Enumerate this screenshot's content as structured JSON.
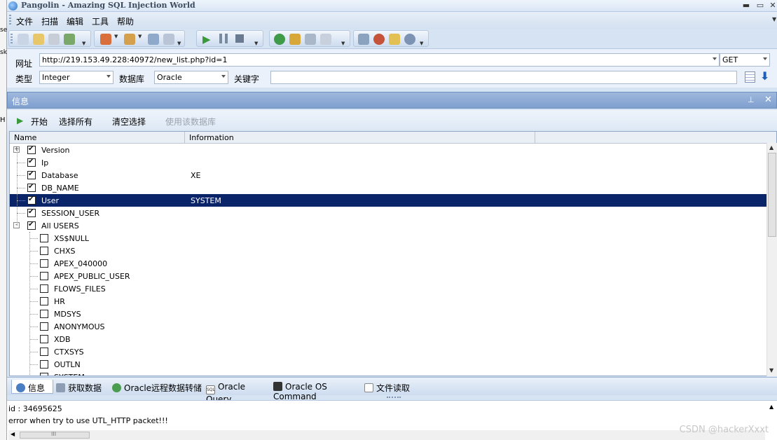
{
  "window": {
    "title": "Pangolin - Amazing SQL Injection World"
  },
  "menu": [
    "文件",
    "扫描",
    "编辑",
    "工具",
    "帮助"
  ],
  "target": {
    "url_label": "网址",
    "url": "http://219.153.49.228:40972/new_list.php?id=1",
    "method": "GET",
    "type_label": "类型",
    "type": "Integer",
    "db_label": "数据库",
    "db": "Oracle",
    "keyword_label": "关键字",
    "keyword": ""
  },
  "panel": {
    "title": "信息"
  },
  "actions": {
    "start": "开始",
    "select_all": "选择所有",
    "clear": "清空选择",
    "use_db": "使用该数据库"
  },
  "grid": {
    "columns": [
      "Name",
      "Information"
    ],
    "rows": [
      {
        "name": "Version",
        "info": "",
        "checked": true,
        "level": 0,
        "expander": "+"
      },
      {
        "name": "Ip",
        "info": "",
        "checked": true,
        "level": 0
      },
      {
        "name": "Database",
        "info": "XE",
        "checked": true,
        "level": 0
      },
      {
        "name": "DB_NAME",
        "info": "",
        "checked": true,
        "level": 0
      },
      {
        "name": "User",
        "info": "SYSTEM",
        "checked": true,
        "level": 0,
        "selected": true
      },
      {
        "name": "SESSION_USER",
        "info": "",
        "checked": true,
        "level": 0
      },
      {
        "name": "All USERS",
        "info": "",
        "checked": true,
        "level": 0,
        "expander": "-"
      },
      {
        "name": "XS$NULL",
        "info": "",
        "checked": false,
        "level": 1
      },
      {
        "name": "CHXS",
        "info": "",
        "checked": false,
        "level": 1
      },
      {
        "name": "APEX_040000",
        "info": "",
        "checked": false,
        "level": 1
      },
      {
        "name": "APEX_PUBLIC_USER",
        "info": "",
        "checked": false,
        "level": 1
      },
      {
        "name": "FLOWS_FILES",
        "info": "",
        "checked": false,
        "level": 1
      },
      {
        "name": "HR",
        "info": "",
        "checked": false,
        "level": 1
      },
      {
        "name": "MDSYS",
        "info": "",
        "checked": false,
        "level": 1
      },
      {
        "name": "ANONYMOUS",
        "info": "",
        "checked": false,
        "level": 1
      },
      {
        "name": "XDB",
        "info": "",
        "checked": false,
        "level": 1
      },
      {
        "name": "CTXSYS",
        "info": "",
        "checked": false,
        "level": 1
      },
      {
        "name": "OUTLN",
        "info": "",
        "checked": false,
        "level": 1
      },
      {
        "name": "SYSTEM",
        "info": "",
        "checked": false,
        "level": 1
      }
    ]
  },
  "tabs": [
    "信息",
    "获取数据",
    "Oracle远程数据转储",
    "Oracle Query",
    "Oracle OS Command",
    "文件读取"
  ],
  "tab_icon_text": {
    "oracle_query": "SQL"
  },
  "active_tab": "信息",
  "log": [
    "id : 34695625",
    "error when try to use UTL_HTTP packet!!!"
  ],
  "scroll": {
    "h_thumb_glyph": "III"
  },
  "left_edge_glyphs": [
    "se",
    "sk",
    "H"
  ],
  "watermark": "CSDN @hackerXxxt",
  "colors": {
    "selection": "#0a246a",
    "panel_header": "#8fabd6",
    "accent": "#2a6fc1"
  },
  "icons": {
    "window": [
      "app-icon",
      "minimize-icon",
      "maximize-icon",
      "close-icon"
    ],
    "toolbar": [
      "search-icon",
      "copy-icon",
      "paste-icon",
      "export-icon",
      "db-icon",
      "palette-icon",
      "wrench-icon",
      "play-icon",
      "pause-icon",
      "stop-icon",
      "help-icon",
      "key-icon",
      "user-icon",
      "magnifier-icon",
      "home-icon",
      "bug-icon",
      "folder-icon",
      "info-icon"
    ]
  }
}
